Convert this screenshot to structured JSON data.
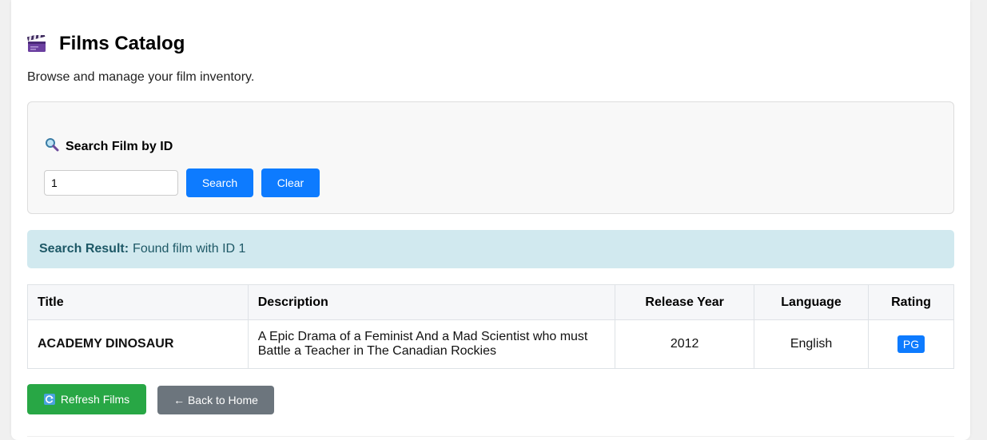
{
  "page": {
    "title": "Films Catalog",
    "subtitle": "Browse and manage your film inventory.",
    "title_icon": "clapperboard-icon"
  },
  "search": {
    "heading": "Search Film by ID",
    "heading_icon": "magnifier-icon",
    "input_value": "1",
    "search_label": "Search",
    "clear_label": "Clear"
  },
  "result": {
    "label": "Search Result:",
    "message": "Found film with ID 1"
  },
  "table": {
    "columns": [
      "Title",
      "Description",
      "Release Year",
      "Language",
      "Rating"
    ],
    "rows": [
      {
        "title": "ACADEMY DINOSAUR",
        "description": "A Epic Drama of a Feminist And a Mad Scientist who must Battle a Teacher in The Canadian Rockies",
        "release_year": "2012",
        "language": "English",
        "rating": "PG"
      }
    ]
  },
  "actions": {
    "refresh_label": "Refresh Films",
    "refresh_icon": "refresh-icon",
    "back_label": "← Back to Home"
  },
  "colors": {
    "primary": "#0d7bff",
    "success": "#28a745",
    "secondary": "#6c757d",
    "info_bg": "#d1e9ef",
    "info_text": "#1d5866"
  }
}
